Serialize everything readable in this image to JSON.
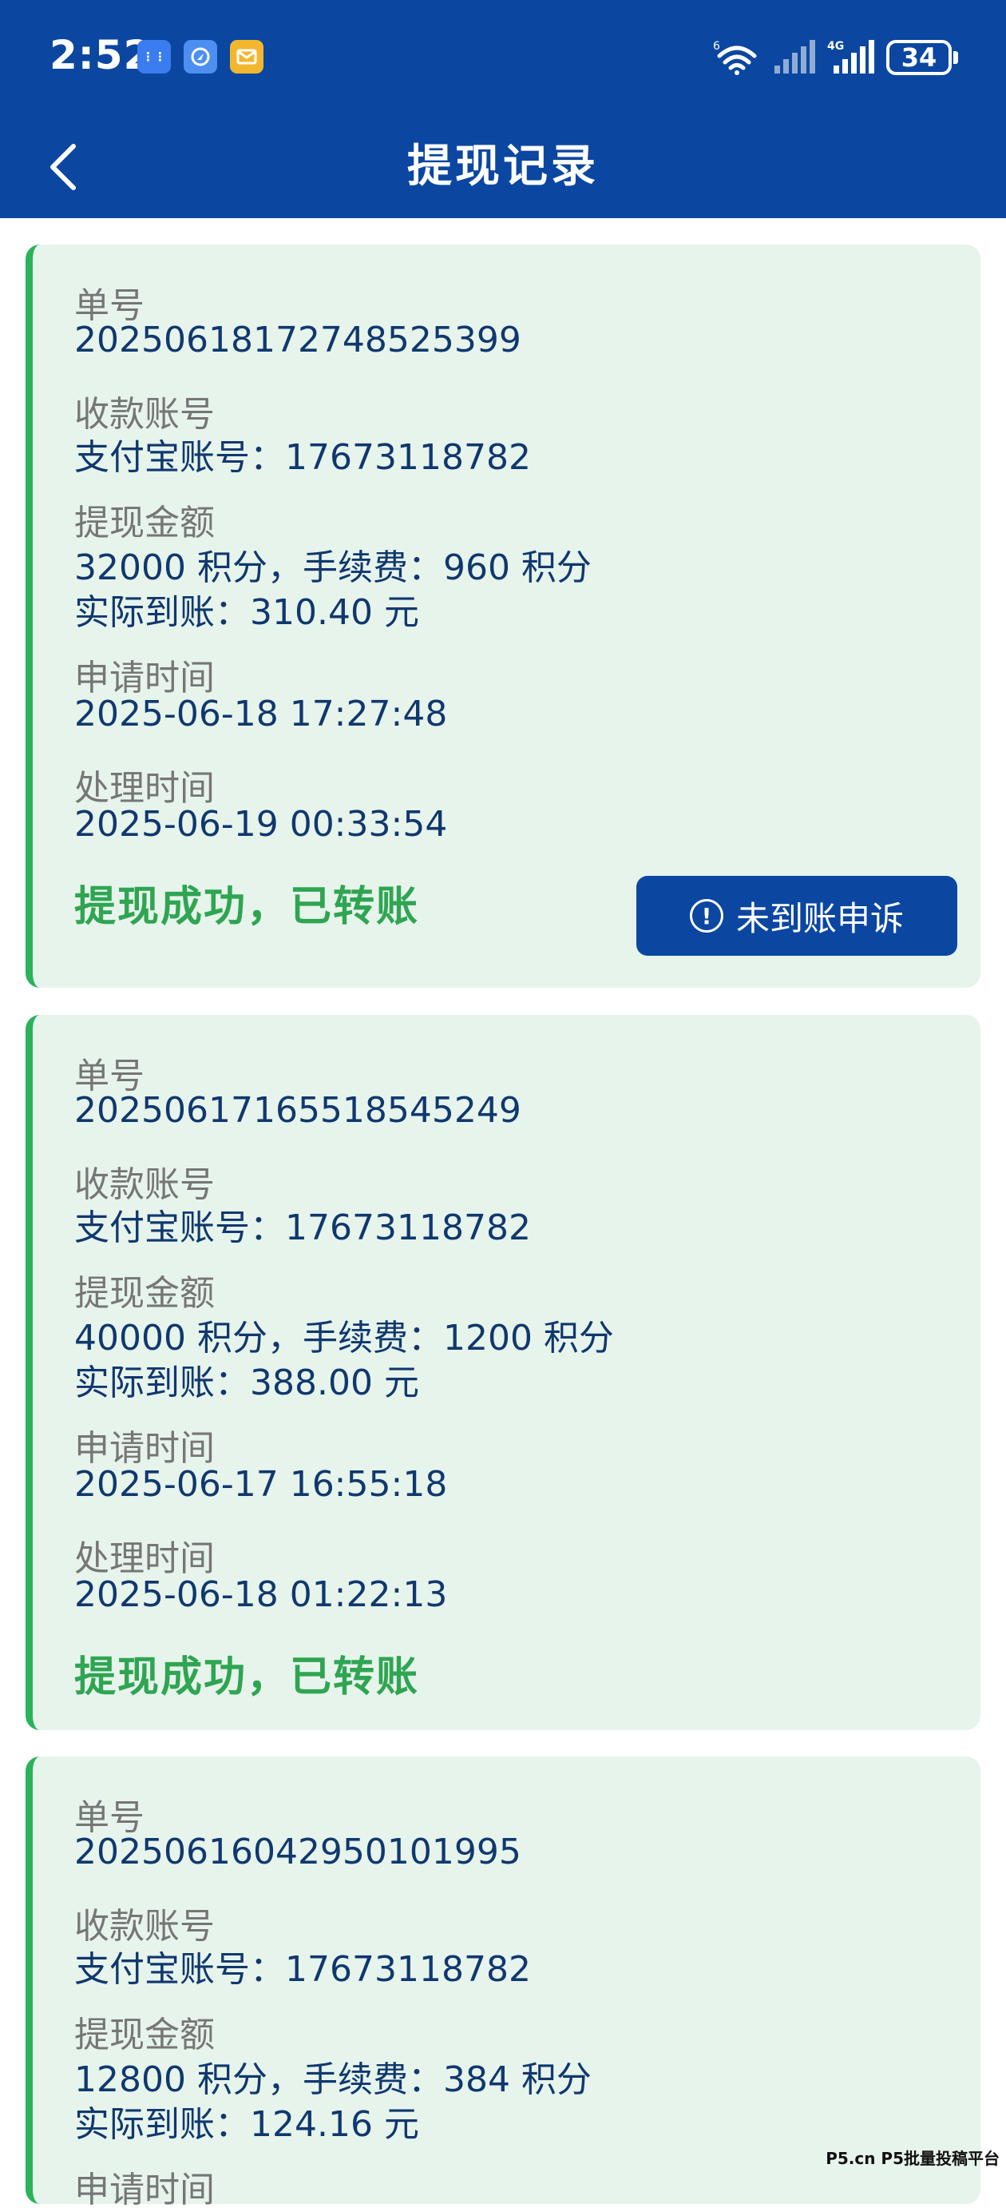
{
  "status_bar": {
    "time": "2:52",
    "app_icons": [
      "app-icon-1",
      "app-icon-2",
      "mail-icon"
    ],
    "wifi_label": "6",
    "network_label": "4G",
    "battery": "34"
  },
  "header": {
    "title": "提现记录",
    "back_icon": "chevron-left-icon"
  },
  "labels": {
    "order_no": "单号",
    "account": "收款账号",
    "amount": "提现金额",
    "apply_time": "申请时间",
    "process_time": "处理时间"
  },
  "records": [
    {
      "order_no": "20250618172748525399",
      "account": "支付宝账号：17673118782",
      "amount": "32000 积分，手续费：960 积分",
      "received": "实际到账：310.40 元",
      "apply_time": "2025-06-18 17:27:48",
      "process_time": "2025-06-19 00:33:54",
      "status": "提现成功，已转账",
      "appeal_label": "未到账申诉"
    },
    {
      "order_no": "20250617165518545249",
      "account": "支付宝账号：17673118782",
      "amount": "40000 积分，手续费：1200 积分",
      "received": "实际到账：388.00 元",
      "apply_time": "2025-06-17 16:55:18",
      "process_time": "2025-06-18 01:22:13",
      "status": "提现成功，已转账"
    },
    {
      "order_no": "20250616042950101995",
      "account": "支付宝账号：17673118782",
      "amount": "12800 积分，手续费：384 积分",
      "received": "实际到账：124.16 元"
    }
  ],
  "watermark": "P5.cn P5批量投稿平台",
  "colors": {
    "header_bg": "#0b47a1",
    "card_bg": "#e7f4ec",
    "accent_green": "#2ab35a",
    "value_text": "#10386e",
    "label_text": "#767676"
  }
}
